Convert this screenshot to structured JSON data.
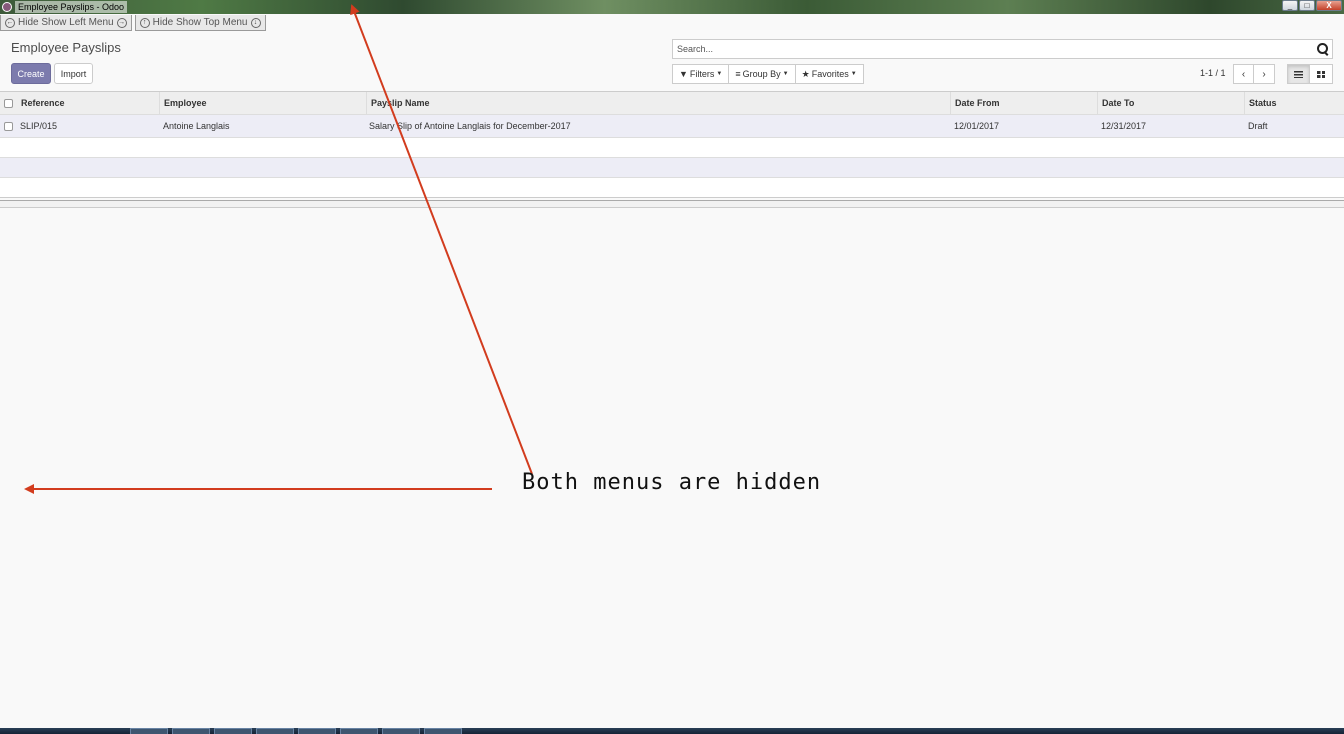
{
  "window": {
    "title": "Employee Payslips - Odoo",
    "controls": [
      "_",
      "□",
      "X"
    ]
  },
  "toggles": {
    "left_menu": "Hide Show Left Menu",
    "top_menu": "Hide Show Top Menu"
  },
  "page": {
    "title": "Employee Payslips",
    "create_label": "Create",
    "import_label": "Import"
  },
  "search": {
    "placeholder": "Search...",
    "filters_label": "Filters",
    "groupby_label": "Group By",
    "favorites_label": "Favorites"
  },
  "pager": {
    "text": "1-1 / 1",
    "prev": "‹",
    "next": "›"
  },
  "table": {
    "columns": [
      "Reference",
      "Employee",
      "Payslip Name",
      "Date From",
      "Date To",
      "Status"
    ],
    "rows": [
      {
        "reference": "SLIP/015",
        "employee": "Antoine Langlais",
        "payslip_name": "Salary Slip of Antoine Langlais for December-2017",
        "date_from": "12/01/2017",
        "date_to": "12/31/2017",
        "status": "Draft"
      }
    ]
  },
  "annotation": {
    "text": "Both menus are hidden",
    "arrow_color": "#d23c1e"
  }
}
